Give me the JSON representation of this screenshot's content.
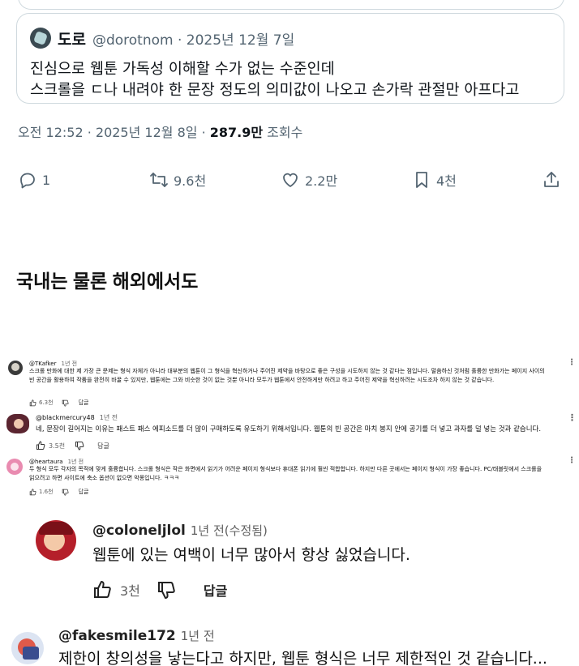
{
  "tweet": {
    "quote": {
      "name": "도로",
      "handle": "@dorotnom · 2025년 12월 7일",
      "line1": "진심으로 웹툰 가독성 이해할 수가 없는 수준인데",
      "line2": "스크롤을 ㄷ나 내려야 한 문장 정도의 의미값이 나오고 손가락 관절만 아프다고"
    },
    "meta_time": "오전 12:52 · 2025년 12월 8일 · ",
    "meta_views": "287.9만",
    "meta_views_label": " 조회수",
    "actions": {
      "reply_count": "1",
      "retweet_count": "9.6천",
      "like_count": "2.2만",
      "bookmark_count": "4천"
    }
  },
  "caption": "국내는 물론 해외에서도",
  "comments": [
    {
      "user": "@TKafker",
      "time": "1년 전",
      "text": "스크롤 만화에 대한 제 가장 큰 문제는 형식 자체가 아니라 대부분의 웹툰이 그 형식을 혁신하거나 주어진 제약을 바탕으로 좋은 구성을 시도하지 않는 것 같다는 점입니다. 말씀하신 것처럼 훌륭한 만화가는 페이지 사이의 빈 공간을 활용하여 작품을 완전히 바꿀 수 있지만, 웹툰에는 그와 비슷한 것이 없는 것뿐 아니라 모두가 웹툰에서 안전하게만 하려고 하고 주어진 제약을 혁신하려는 시도조차 하지 않는 것 같습니다.",
      "likes": "6.3천",
      "reply": "답글"
    },
    {
      "user": "@blackmercury48",
      "time": "1년 전",
      "text": "네, 문장이 길어지는 이유는 패스트 패스 에피소드를 더 많이 구매하도록 유도하기 위해서입니다. 웹툰의 빈 공간은 마치 봉지 안에 공기를 더 넣고 과자를 덜 넣는 것과 같습니다.",
      "likes": "3.5천",
      "reply": "답글"
    },
    {
      "user": "@heartaura",
      "time": "1년 전",
      "text": "두 형식 모두 각자의 목적에 맞게 훌륭합니다. 스크롤 형식은 작은 화면에서 읽기가 어려운 페이지 형식보다 휴대폰 읽기에 훨씬 적합합니다. 하지만 다른 곳에서는 페이지 형식이 가장 좋습니다. PC/태블릿에서 스크롤을 읽으려고 하면 사이트에 축소 옵션이 없으면 악몽입니다. ㅋㅋㅋ",
      "likes": "1.6천",
      "reply": "답글"
    },
    {
      "user": "@coloneljlol",
      "time": "1년 전(수정됨)",
      "text": "웹툰에 있는 여백이 너무 많아서 항상 싫었습니다.",
      "likes": "3천",
      "reply": "답글"
    },
    {
      "user": "@fakesmile172",
      "time": "1년 전",
      "text": "제한이 창의성을 낳는다고 하지만, 웹툰 형식은 너무 제한적인 것 같습니다..."
    }
  ]
}
